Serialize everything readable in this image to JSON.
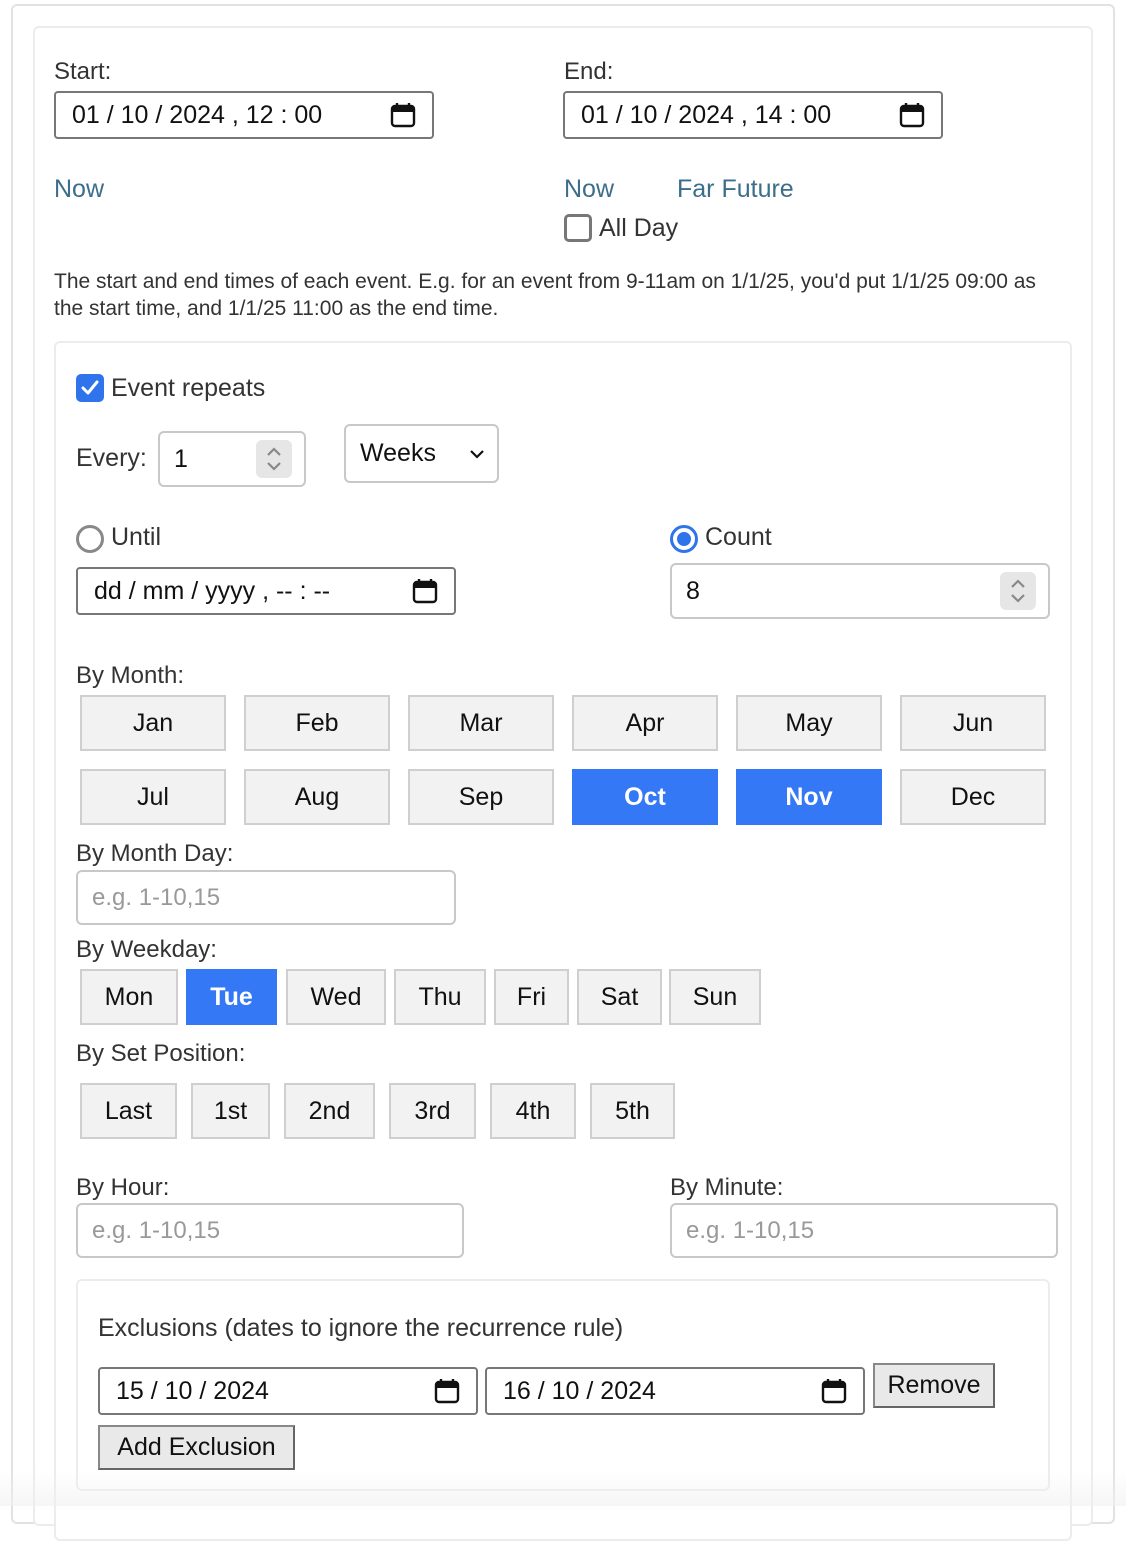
{
  "start": {
    "label": "Start:",
    "value": "01 / 10 / 2024 ,   12 : 00",
    "now_link": "Now"
  },
  "end": {
    "label": "End:",
    "value": "01 / 10 / 2024 ,   14 : 00",
    "now_link": "Now",
    "far_future_link": "Far Future",
    "all_day_label": "All Day",
    "all_day_checked": false
  },
  "help_text": "The start and end times of each event. E.g. for an event from 9-11am on 1/1/25, you'd put 1/1/25 09:00 as the start time, and 1/1/25 11:00 as the end time.",
  "recurrence": {
    "repeats_label": "Event repeats",
    "repeats_checked": true,
    "every_label": "Every:",
    "every_value": "1",
    "frequency": "Weeks",
    "until_label": "Until",
    "until_placeholder": "dd / mm / yyyy ,   -- : --",
    "count_label": "Count",
    "count_value": "8",
    "end_mode": "count"
  },
  "by_month": {
    "label": "By Month:",
    "months": [
      "Jan",
      "Feb",
      "Mar",
      "Apr",
      "May",
      "Jun",
      "Jul",
      "Aug",
      "Sep",
      "Oct",
      "Nov",
      "Dec"
    ],
    "selected": [
      "Oct",
      "Nov"
    ]
  },
  "by_month_day": {
    "label": "By Month Day:",
    "placeholder": "e.g. 1-10,15"
  },
  "by_weekday": {
    "label": "By Weekday:",
    "days": [
      "Mon",
      "Tue",
      "Wed",
      "Thu",
      "Fri",
      "Sat",
      "Sun"
    ],
    "selected": [
      "Tue"
    ]
  },
  "by_set_position": {
    "label": "By Set Position:",
    "positions": [
      "Last",
      "1st",
      "2nd",
      "3rd",
      "4th",
      "5th"
    ]
  },
  "by_hour": {
    "label": "By Hour:",
    "placeholder": "e.g. 1-10,15"
  },
  "by_minute": {
    "label": "By Minute:",
    "placeholder": "e.g. 1-10,15"
  },
  "exclusions": {
    "title": "Exclusions (dates to ignore the recurrence rule)",
    "dates": [
      "15 / 10 / 2024",
      "16 / 10 / 2024"
    ],
    "remove_label": "Remove",
    "add_label": "Add Exclusion"
  },
  "colors": {
    "accent": "#3478f6",
    "link": "#3c6e8c"
  }
}
